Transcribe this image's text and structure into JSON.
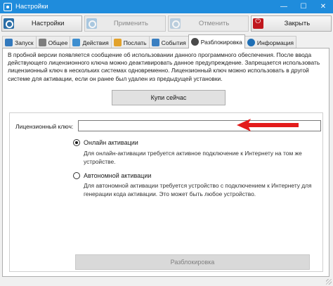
{
  "window": {
    "title": "Настройки",
    "minimize": "—",
    "maximize": "☐",
    "close": "✕"
  },
  "toolbar": {
    "settings_label": "Настройки",
    "apply_label": "Применить",
    "cancel_label": "Отменить",
    "close_label": "Закрыть"
  },
  "tabs": [
    {
      "label": "Запуск"
    },
    {
      "label": "Общее"
    },
    {
      "label": "Действия"
    },
    {
      "label": "Послать"
    },
    {
      "label": "События"
    },
    {
      "label": "Разблокировка",
      "active": true
    },
    {
      "label": "Информация"
    }
  ],
  "unlock": {
    "intro_text": "В пробной версии появляется сообщение об использовании данного программного обеспечения. После ввода действующего лицензионного ключа можно деактивировать данное предупреждение. Запрещается использовать лицензионный ключ в нескольких системах одновременно. Лицензионный ключ можно использовать в другой системе для активации, если он ранее был удален из предыдущей установки.",
    "buy_button": "Купи сейчас",
    "key_label": "Лицензионный ключ:",
    "key_value": "",
    "online_label": "Онлайн активации",
    "online_desc": "Для онлайн-активации требуется активное подключение к Интернету на том же устройстве.",
    "offline_label": "Автономной активации",
    "offline_desc": "Для автономной активации требуется устройство с подключением к Интернету для генерации кода активации. Это может быть любое устройство.",
    "unlock_button": "Разблокировка",
    "selected_mode": "online"
  },
  "colors": {
    "titlebar": "#1f8cdc",
    "arrow": "#e31b1b"
  }
}
